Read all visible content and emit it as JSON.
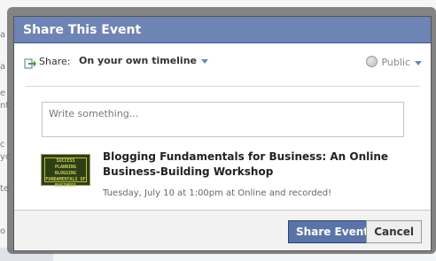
{
  "dialog": {
    "title": "Share This Event",
    "share": {
      "label": "Share:",
      "target": "On your own timeline",
      "audience": "Public"
    },
    "composer": {
      "placeholder": "Write something..."
    },
    "event": {
      "title": "Blogging Fundamentals for Business: An Online Business-Building Workshop",
      "datetime": "Tuesday, July 10 at 1:00pm at Online and recorded!",
      "thumbnail_text": "SUCCESS PLANNING BLOGGING FUNDAMENTALS OF BUSINESS"
    },
    "buttons": {
      "primary": "Share Event",
      "cancel": "Cancel"
    }
  },
  "colors": {
    "header": "#6d84b4",
    "primary_button": "#5b74a8",
    "overlay": "#525252"
  }
}
